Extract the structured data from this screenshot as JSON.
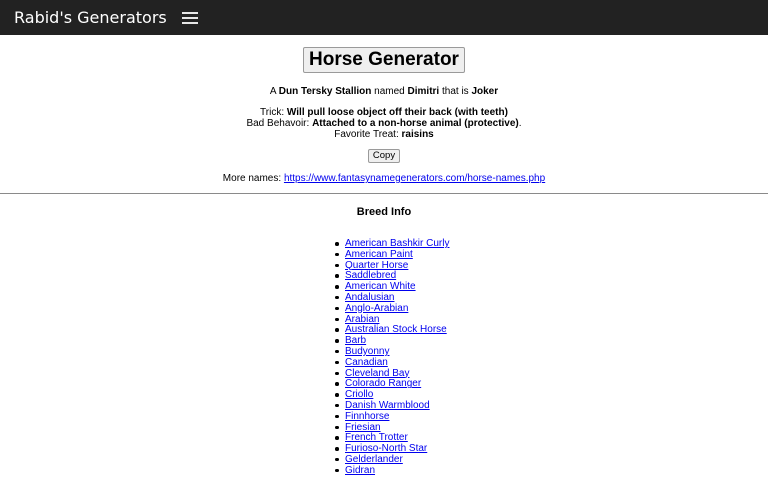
{
  "navbar": {
    "brand": "Rabid's Generators",
    "menu_icon": "hamburger-menu-icon"
  },
  "generator": {
    "title": "Horse Generator",
    "result": {
      "prefix": "A",
      "breed": "Dun Tersky Stallion",
      "named_text": "named",
      "name": "Dimitri",
      "that_is_text": "that is",
      "trait": "Joker"
    },
    "trick_label": "Trick:",
    "trick_value": "Will pull loose object off their back (with teeth)",
    "bad_behavior_label": "Bad Behavoir:",
    "bad_behavior_value": "Attached to a non-horse animal (protective)",
    "bad_behavior_suffix": ".",
    "favorite_treat_label": "Favorite Treat:",
    "favorite_treat_value": "raisins",
    "copy_label": "Copy",
    "more_names_label": "More names:",
    "more_names_link": "https://www.fantasynamegenerators.com/horse-names.php"
  },
  "breed_info": {
    "heading": "Breed Info",
    "items": [
      "American Bashkir Curly",
      "American Paint",
      "Quarter Horse",
      "Saddlebred",
      "American White",
      "Andalusian",
      "Anglo-Arabian",
      "Arabian",
      "Australian Stock Horse",
      "Barb",
      "Budyonny",
      "Canadian",
      "Cleveland Bay",
      "Colorado Ranger",
      "Criollo",
      "Danish Warmblood",
      "Finnhorse",
      "Friesian",
      "French Trotter",
      "Furioso-North Star",
      "Gelderlander",
      "Gidran"
    ]
  }
}
